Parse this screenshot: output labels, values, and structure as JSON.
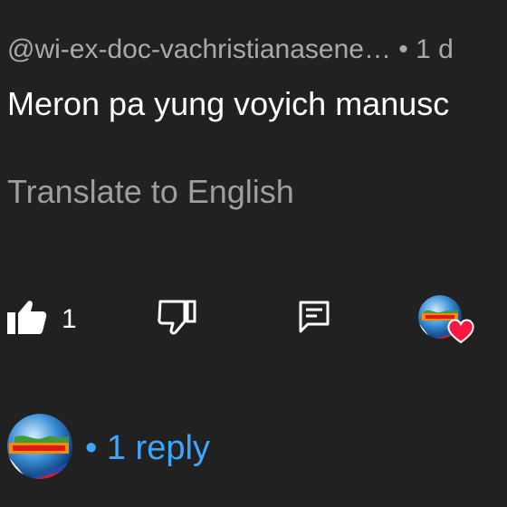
{
  "comment": {
    "meta": "@wi-ex-doc-vachristianasene… • 1 d",
    "text": "Meron pa yung voyich manusc",
    "translate_label": "Translate to English"
  },
  "actions": {
    "like_count": "1",
    "like_icon": "thumbs-up-icon",
    "dislike_icon": "thumbs-down-icon",
    "reply_icon": "comment-icon",
    "creator_heart_icon": "heart-icon"
  },
  "replies": {
    "link_label": "• 1 reply"
  },
  "colors": {
    "background": "#212121",
    "meta_text": "#a9a9a9",
    "body_text": "#ffffff",
    "translate_text": "#9e9e9e",
    "reply_link": "#3ea6ff",
    "heart": "#ff1744"
  }
}
